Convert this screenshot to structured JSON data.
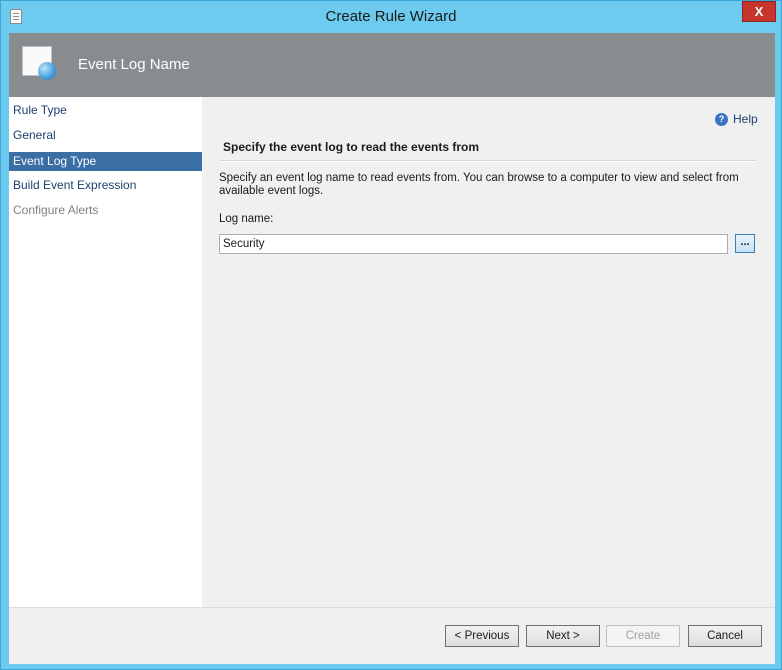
{
  "window": {
    "title": "Create Rule Wizard",
    "close_glyph": "X",
    "icon": "document-icon"
  },
  "header": {
    "title": "Event Log Name",
    "icon": "page-globe-icon"
  },
  "nav": {
    "items": [
      {
        "label": "Rule Type",
        "state": "normal"
      },
      {
        "label": "General",
        "state": "normal"
      },
      {
        "label": "Event Log Type",
        "state": "selected"
      },
      {
        "label": "Build Event Expression",
        "state": "normal"
      },
      {
        "label": "Configure Alerts",
        "state": "disabled"
      }
    ]
  },
  "content": {
    "help_label": "Help",
    "section_title": "Specify the event log to read the events from",
    "description": "Specify an event log name to read events from. You can browse to a computer to view and select from available event logs.",
    "log_name_label": "Log name:",
    "log_name_value": "Security",
    "browse_label": "..."
  },
  "footer": {
    "previous_label": "< Previous",
    "next_label": "Next >",
    "create_label": "Create",
    "cancel_label": "Cancel"
  },
  "colors": {
    "frame": "#6ccbef",
    "header_band": "#898c8e",
    "nav_selected": "#3a6ea5",
    "close_button": "#c7352f"
  }
}
